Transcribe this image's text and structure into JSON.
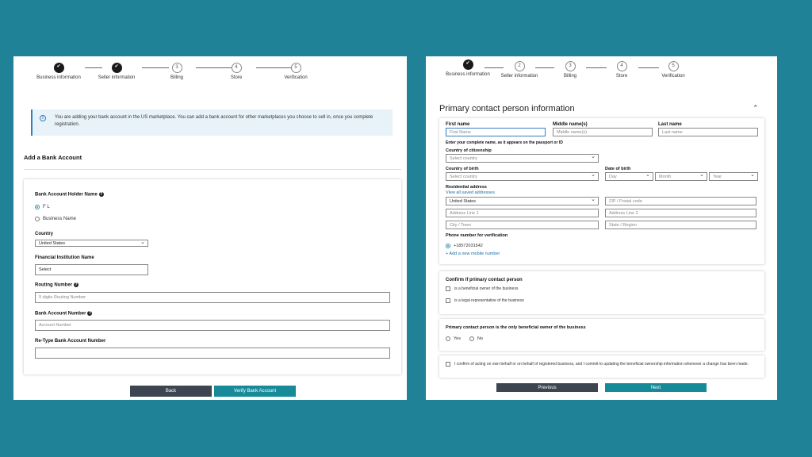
{
  "left": {
    "steps": [
      {
        "num": "",
        "label": "Business information",
        "done": true
      },
      {
        "num": "",
        "label": "Seller information",
        "done": true
      },
      {
        "num": "3",
        "label": "Billing",
        "done": false
      },
      {
        "num": "4",
        "label": "Store",
        "done": false
      },
      {
        "num": "5",
        "label": "Verification",
        "done": false
      }
    ],
    "info_text": "You are adding your bank account in the US marketplace. You can add a bank account for other marketplaces you choose to sell in, once you complete registration.",
    "section_title": "Add a Bank Account",
    "holder_label": "Bank Account Holder Name",
    "holder_options": [
      "F L",
      "Business Name"
    ],
    "country_label": "Country",
    "country_value": "United States",
    "institution_label": "Financial Institution Name",
    "institution_value": "Select",
    "routing_label": "Routing Number",
    "routing_placeholder": "9 digits Routing Number",
    "account_label": "Bank Account Number",
    "account_placeholder": "Account Number",
    "retype_label": "Re-Type Bank Account Number",
    "back_label": "Back",
    "verify_label": "Verify Bank Account"
  },
  "right": {
    "steps": [
      {
        "num": "",
        "label": "Business information",
        "done": true
      },
      {
        "num": "2",
        "label": "Seller information",
        "done": false
      },
      {
        "num": "3",
        "label": "Billing",
        "done": false
      },
      {
        "num": "4",
        "label": "Store",
        "done": false
      },
      {
        "num": "5",
        "label": "Verification",
        "done": false
      }
    ],
    "section_title": "Primary contact person information",
    "first_name_label": "First name",
    "first_name_placeholder": "First Name",
    "middle_name_label": "Middle name(s)",
    "middle_name_placeholder": "Middle name(s)",
    "last_name_label": "Last name",
    "last_name_placeholder": "Last name",
    "name_hint": "Enter your complete name, as it appears on the passport or ID",
    "citizenship_label": "Country of citizenship",
    "citizenship_value": "Select country",
    "birth_country_label": "Country of birth",
    "birth_country_value": "Select country",
    "dob_label": "Date of birth",
    "dob_day": "Day",
    "dob_month": "Month",
    "dob_year": "Year",
    "address_label": "Residential address",
    "saved_addresses_link": "View all saved addresses",
    "address_country": "United States",
    "zip_placeholder": "ZIP / Postal code",
    "line1_placeholder": "Address Line 1",
    "line2_placeholder": "Address Line 2",
    "city_placeholder": "City / Town",
    "state_placeholder": "State / Region",
    "phone_label": "Phone number for verification",
    "phone_value": "+18572031542",
    "add_mobile_link": "+ Add a new mobile number",
    "confirm_title": "Confirm if primary contact person",
    "confirm_opts": [
      "is a beneficial owner of the business",
      "is a legal representative of the business"
    ],
    "only_owner_title": "Primary contact person is the only beneficial owner of the business",
    "yes_label": "Yes",
    "no_label": "No",
    "ack_text": "I confirm of acting on own behalf or on behalf of registered business, and I commit to updating the beneficial ownership information whenever a change has been made.",
    "previous_label": "Previous",
    "next_label": "Next"
  }
}
